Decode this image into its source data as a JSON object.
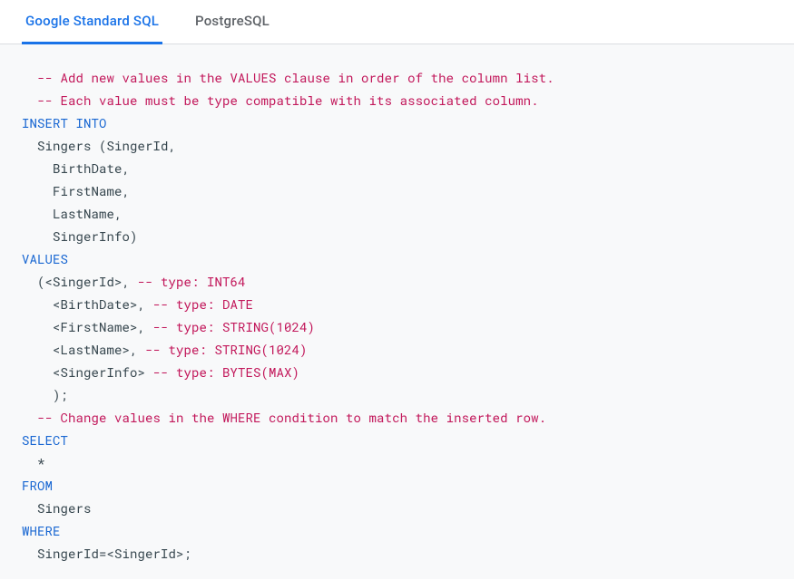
{
  "tabs": [
    {
      "label": "Google Standard SQL",
      "active": true
    },
    {
      "label": "PostgreSQL",
      "active": false
    }
  ],
  "code": {
    "tokens": [
      {
        "cls": "c-comment",
        "t": "  -- Add new values in the VALUES clause in order of the column list.\n"
      },
      {
        "cls": "c-comment",
        "t": "  -- Each value must be type compatible with its associated column.\n"
      },
      {
        "cls": "c-keyword",
        "t": "INSERT INTO"
      },
      {
        "cls": "c-text",
        "t": "\n  Singers (SingerId,\n    BirthDate,\n    FirstName,\n    LastName,\n    SingerInfo)\n"
      },
      {
        "cls": "c-keyword",
        "t": "VALUES"
      },
      {
        "cls": "c-text",
        "t": "\n  (<SingerId>, "
      },
      {
        "cls": "c-comment",
        "t": "-- type: INT64"
      },
      {
        "cls": "c-text",
        "t": "\n    <BirthDate>, "
      },
      {
        "cls": "c-comment",
        "t": "-- type: DATE"
      },
      {
        "cls": "c-text",
        "t": "\n    <FirstName>, "
      },
      {
        "cls": "c-comment",
        "t": "-- type: STRING(1024)"
      },
      {
        "cls": "c-text",
        "t": "\n    <LastName>, "
      },
      {
        "cls": "c-comment",
        "t": "-- type: STRING(1024)"
      },
      {
        "cls": "c-text",
        "t": "\n    <SingerInfo> "
      },
      {
        "cls": "c-comment",
        "t": "-- type: BYTES(MAX)"
      },
      {
        "cls": "c-text",
        "t": "\n    );\n"
      },
      {
        "cls": "c-comment",
        "t": "  -- Change values in the WHERE condition to match the inserted row.\n"
      },
      {
        "cls": "c-keyword",
        "t": "SELECT"
      },
      {
        "cls": "c-text",
        "t": "\n  *\n"
      },
      {
        "cls": "c-keyword",
        "t": "FROM"
      },
      {
        "cls": "c-text",
        "t": "\n  Singers\n"
      },
      {
        "cls": "c-keyword",
        "t": "WHERE"
      },
      {
        "cls": "c-text",
        "t": "\n  SingerId=<SingerId>;"
      }
    ]
  }
}
